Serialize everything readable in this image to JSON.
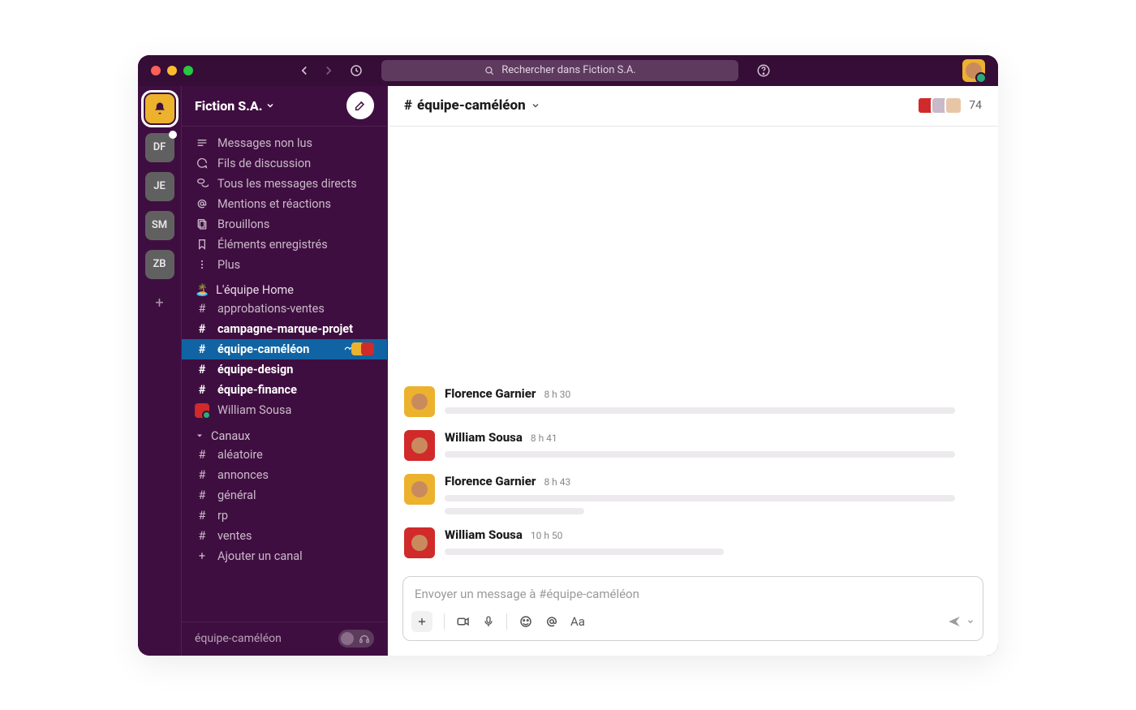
{
  "search": {
    "placeholder": "Rechercher dans Fiction S.A."
  },
  "workspaces": {
    "items": [
      {
        "label": ""
      },
      {
        "label": "DF"
      },
      {
        "label": "JE"
      },
      {
        "label": "SM"
      },
      {
        "label": "ZB"
      }
    ]
  },
  "sidebar": {
    "workspace_name": "Fiction S.A.",
    "nav": {
      "unreads": "Messages non lus",
      "threads": "Fils de discussion",
      "dms": "Tous les messages directs",
      "mentions": "Mentions et réactions",
      "drafts": "Brouillons",
      "saved": "Éléments enregistrés",
      "more": "Plus"
    },
    "team_section": "L'équipe Home",
    "channels_section": "Canaux",
    "team_channels": [
      {
        "name": "approbations-ventes",
        "bold": false
      },
      {
        "name": "campagne-marque-projet",
        "bold": true
      },
      {
        "name": "équipe-caméléon",
        "bold": true,
        "selected": true,
        "huddle": true
      },
      {
        "name": "équipe-design",
        "bold": true
      },
      {
        "name": "équipe-finance",
        "bold": true
      }
    ],
    "dm": {
      "name": "William Sousa"
    },
    "channels": [
      {
        "name": "aléatoire"
      },
      {
        "name": "annonces"
      },
      {
        "name": "général"
      },
      {
        "name": "rp"
      },
      {
        "name": "ventes"
      }
    ],
    "add_channel": "Ajouter un canal",
    "footer_channel": "équipe-caméléon"
  },
  "channel": {
    "name": "équipe-caméléon",
    "member_count": "74"
  },
  "messages": [
    {
      "author": "Florence Garnier",
      "time": "8 h 30",
      "avatar": "y",
      "lines": 1
    },
    {
      "author": "William Sousa",
      "time": "8 h 41",
      "avatar": "r",
      "lines": 1
    },
    {
      "author": "Florence Garnier",
      "time": "8 h 43",
      "avatar": "y",
      "lines": 2
    },
    {
      "author": "William Sousa",
      "time": "10 h 50",
      "avatar": "r",
      "lines": 1,
      "short": true
    }
  ],
  "composer": {
    "placeholder": "Envoyer un message à #équipe-caméléon"
  }
}
